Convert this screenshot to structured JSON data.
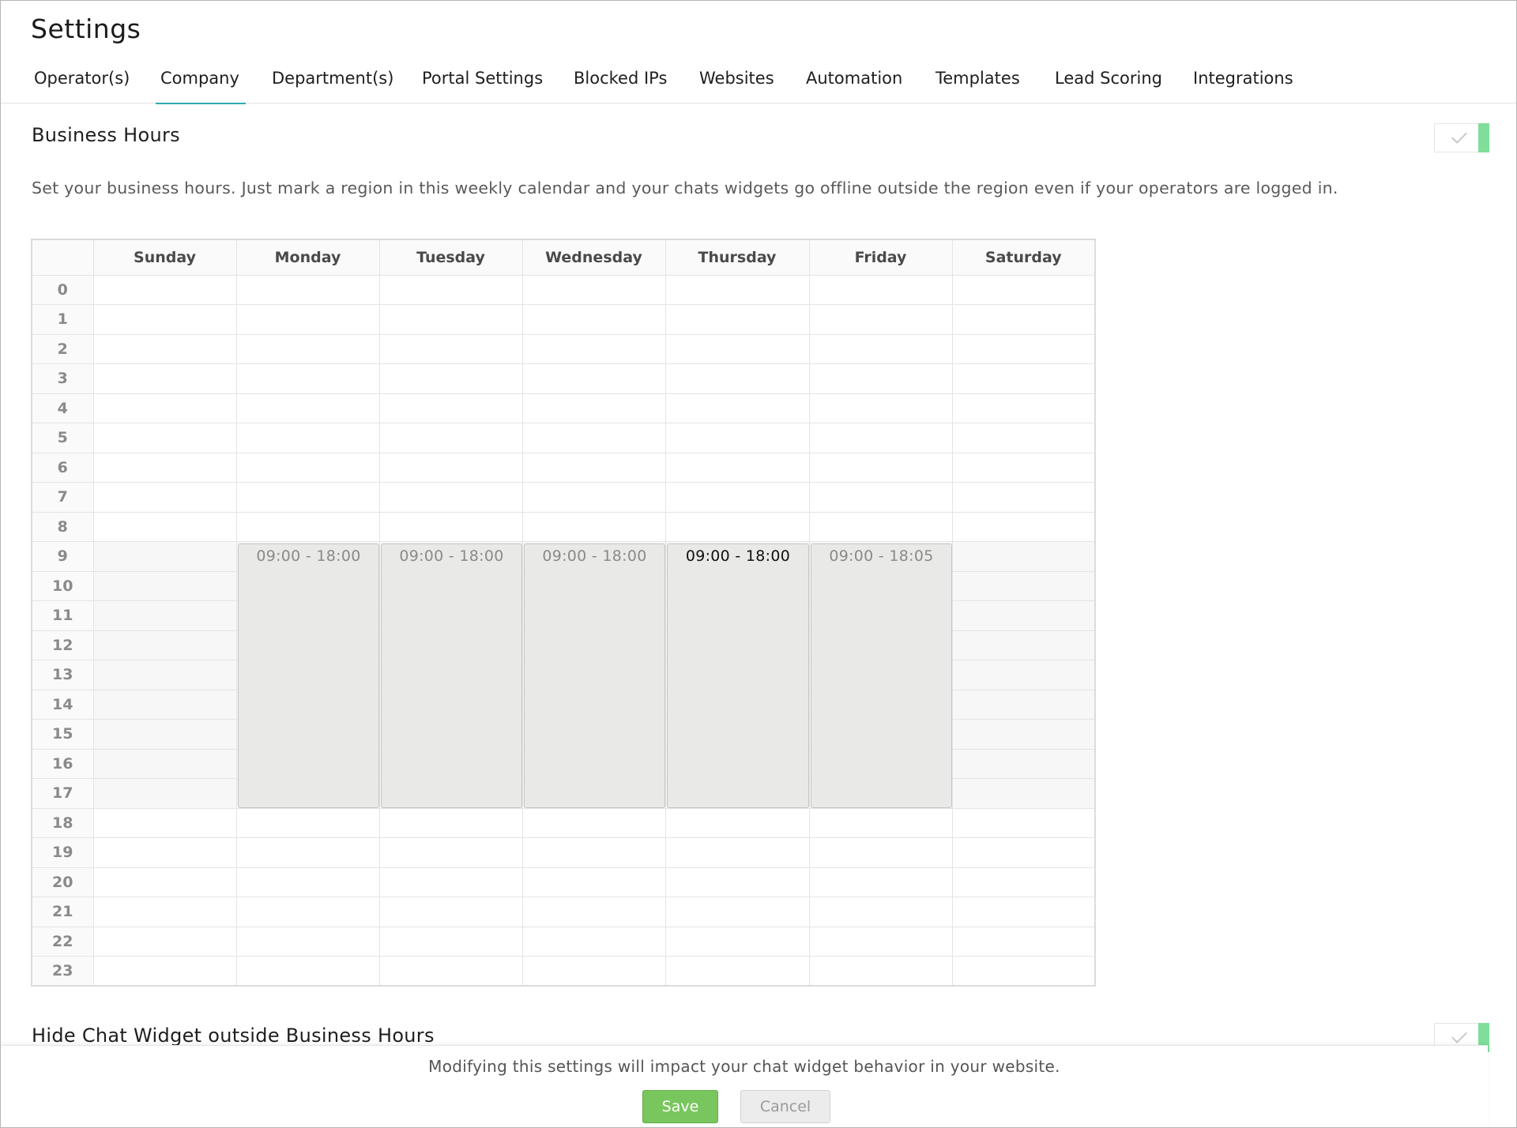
{
  "page": {
    "title": "Settings"
  },
  "tabs": [
    {
      "label": "Operator(s)",
      "active": false
    },
    {
      "label": "Company",
      "active": true
    },
    {
      "label": "Department(s)",
      "active": false
    },
    {
      "label": "Portal Settings",
      "active": false
    },
    {
      "label": "Blocked IPs",
      "active": false
    },
    {
      "label": "Websites",
      "active": false
    },
    {
      "label": "Automation",
      "active": false
    },
    {
      "label": "Templates",
      "active": false
    },
    {
      "label": "Lead Scoring",
      "active": false
    },
    {
      "label": "Integrations",
      "active": false
    }
  ],
  "business_hours": {
    "title": "Business Hours",
    "toggle_icon": "check-icon",
    "description": "Set your business hours. Just mark a region in this weekly calendar and your chats widgets go offline outside the region even if your operators are logged in.",
    "days": [
      "Sunday",
      "Monday",
      "Tuesday",
      "Wednesday",
      "Thursday",
      "Friday",
      "Saturday"
    ],
    "hours": [
      "0",
      "1",
      "2",
      "3",
      "4",
      "5",
      "6",
      "7",
      "8",
      "9",
      "10",
      "11",
      "12",
      "13",
      "14",
      "15",
      "16",
      "17",
      "18",
      "19",
      "20",
      "21",
      "22",
      "23"
    ],
    "slots": [
      {
        "day": "Monday",
        "label": "09:00 - 18:00",
        "start": 9,
        "end": 18
      },
      {
        "day": "Tuesday",
        "label": "09:00 - 18:00",
        "start": 9,
        "end": 18
      },
      {
        "day": "Wednesday",
        "label": "09:00 - 18:00",
        "start": 9,
        "end": 18
      },
      {
        "day": "Thursday",
        "label": "09:00 - 18:00",
        "start": 9,
        "end": 18
      },
      {
        "day": "Friday",
        "label": "09:00 - 18:05",
        "start": 9,
        "end": 18
      }
    ]
  },
  "hide_widget": {
    "title": "Hide Chat Widget outside Business Hours",
    "toggle_icon": "check-icon"
  },
  "footer": {
    "message": "Modifying this settings will impact your chat widget behavior in your website.",
    "save_label": "Save",
    "cancel_label": "Cancel"
  },
  "colors": {
    "accent": "#2eaab4",
    "toggle_on": "#7fde9a",
    "save_button": "#78c65d"
  }
}
